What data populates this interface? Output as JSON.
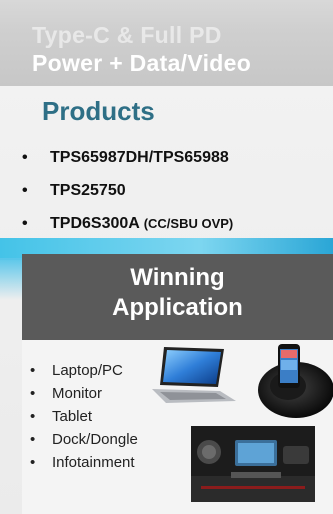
{
  "slide": {
    "title_line1": "Type-C & Full PD",
    "title_line2": "Power + Data/Video",
    "products": {
      "heading": "Products",
      "items": [
        {
          "label": "TPS65987DH/TPS65988",
          "note": ""
        },
        {
          "label": "TPS25750",
          "note": ""
        },
        {
          "label": "TPD6S300A",
          "note": "(CC/SBU OVP)"
        }
      ],
      "bullet": "•"
    },
    "winning": {
      "line1": "Winning",
      "line2": "Application"
    },
    "applications": {
      "items": [
        "Laptop/PC",
        "Monitor",
        "Tablet",
        "Dock/Dongle",
        "Infotainment"
      ],
      "bullet": "•"
    },
    "colors": {
      "heading_accent": "#2e6f86",
      "winning_bg": "#5a5a5a",
      "cyan_accent": "#44c3e8"
    },
    "icons": [
      "laptop-image",
      "phone-dock-image",
      "car-dashboard-image"
    ]
  }
}
